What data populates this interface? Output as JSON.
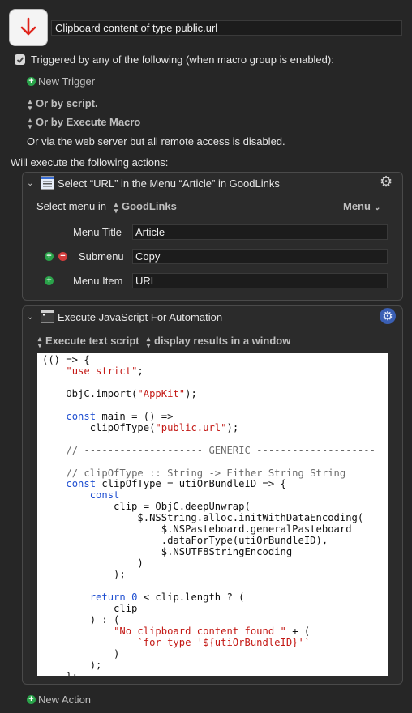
{
  "macro": {
    "title": "Clipboard content of type public.url",
    "icon": "arrow-down-circle-icon"
  },
  "triggers": {
    "checkbox_label": "Triggered by any of the following (when macro group is enabled):",
    "new_trigger": "New Trigger",
    "or_by_script": "Or by script.",
    "or_by_execute_macro": "Or by Execute Macro",
    "web_server_note": "Or via the web server but all remote access is disabled."
  },
  "actions_header": "Will execute the following actions:",
  "action1": {
    "title": "Select “URL” in the Menu “Article” in GoodLinks",
    "select_menu_in_label": "Select menu in",
    "app": "GoodLinks",
    "menu_mode": "Menu",
    "menu_title_label": "Menu Title",
    "menu_title_value": "Article",
    "submenu_label": "Submenu",
    "submenu_value": "Copy",
    "menu_item_label": "Menu Item",
    "menu_item_value": "URL"
  },
  "action2": {
    "title": "Execute JavaScript For Automation",
    "execute_mode": "Execute text script",
    "results_mode": "display results in a window",
    "code_lines": [
      "(() => {",
      "    \"use strict\";",
      "",
      "    ObjC.import(\"AppKit\");",
      "",
      "    const main = () =>",
      "        clipOfType(\"public.url\");",
      "",
      "    // -------------------- GENERIC --------------------",
      "",
      "    // clipOfType :: String -> Either String String",
      "    const clipOfType = utiOrBundleID => {",
      "        const",
      "            clip = ObjC.deepUnwrap(",
      "                $.NSString.alloc.initWithDataEncoding(",
      "                    $.NSPasteboard.generalPasteboard",
      "                    .dataForType(utiOrBundleID),",
      "                    $.NSUTF8StringEncoding",
      "                )",
      "            );",
      "",
      "        return 0 < clip.length ? (",
      "            clip",
      "        ) : (",
      "            \"No clipboard content found \" + (",
      "                `for type '${utiOrBundleID}'`",
      "            )",
      "        );",
      "    };"
    ]
  },
  "new_action": "New Action",
  "colors": {
    "background": "#262626",
    "panel": "#2b2b2b",
    "add_green": "#2aa34a",
    "remove_red": "#d23c3c",
    "arrow_red": "#e0241b",
    "keyword_blue": "#1f4fd1",
    "string_red": "#c41a16"
  }
}
